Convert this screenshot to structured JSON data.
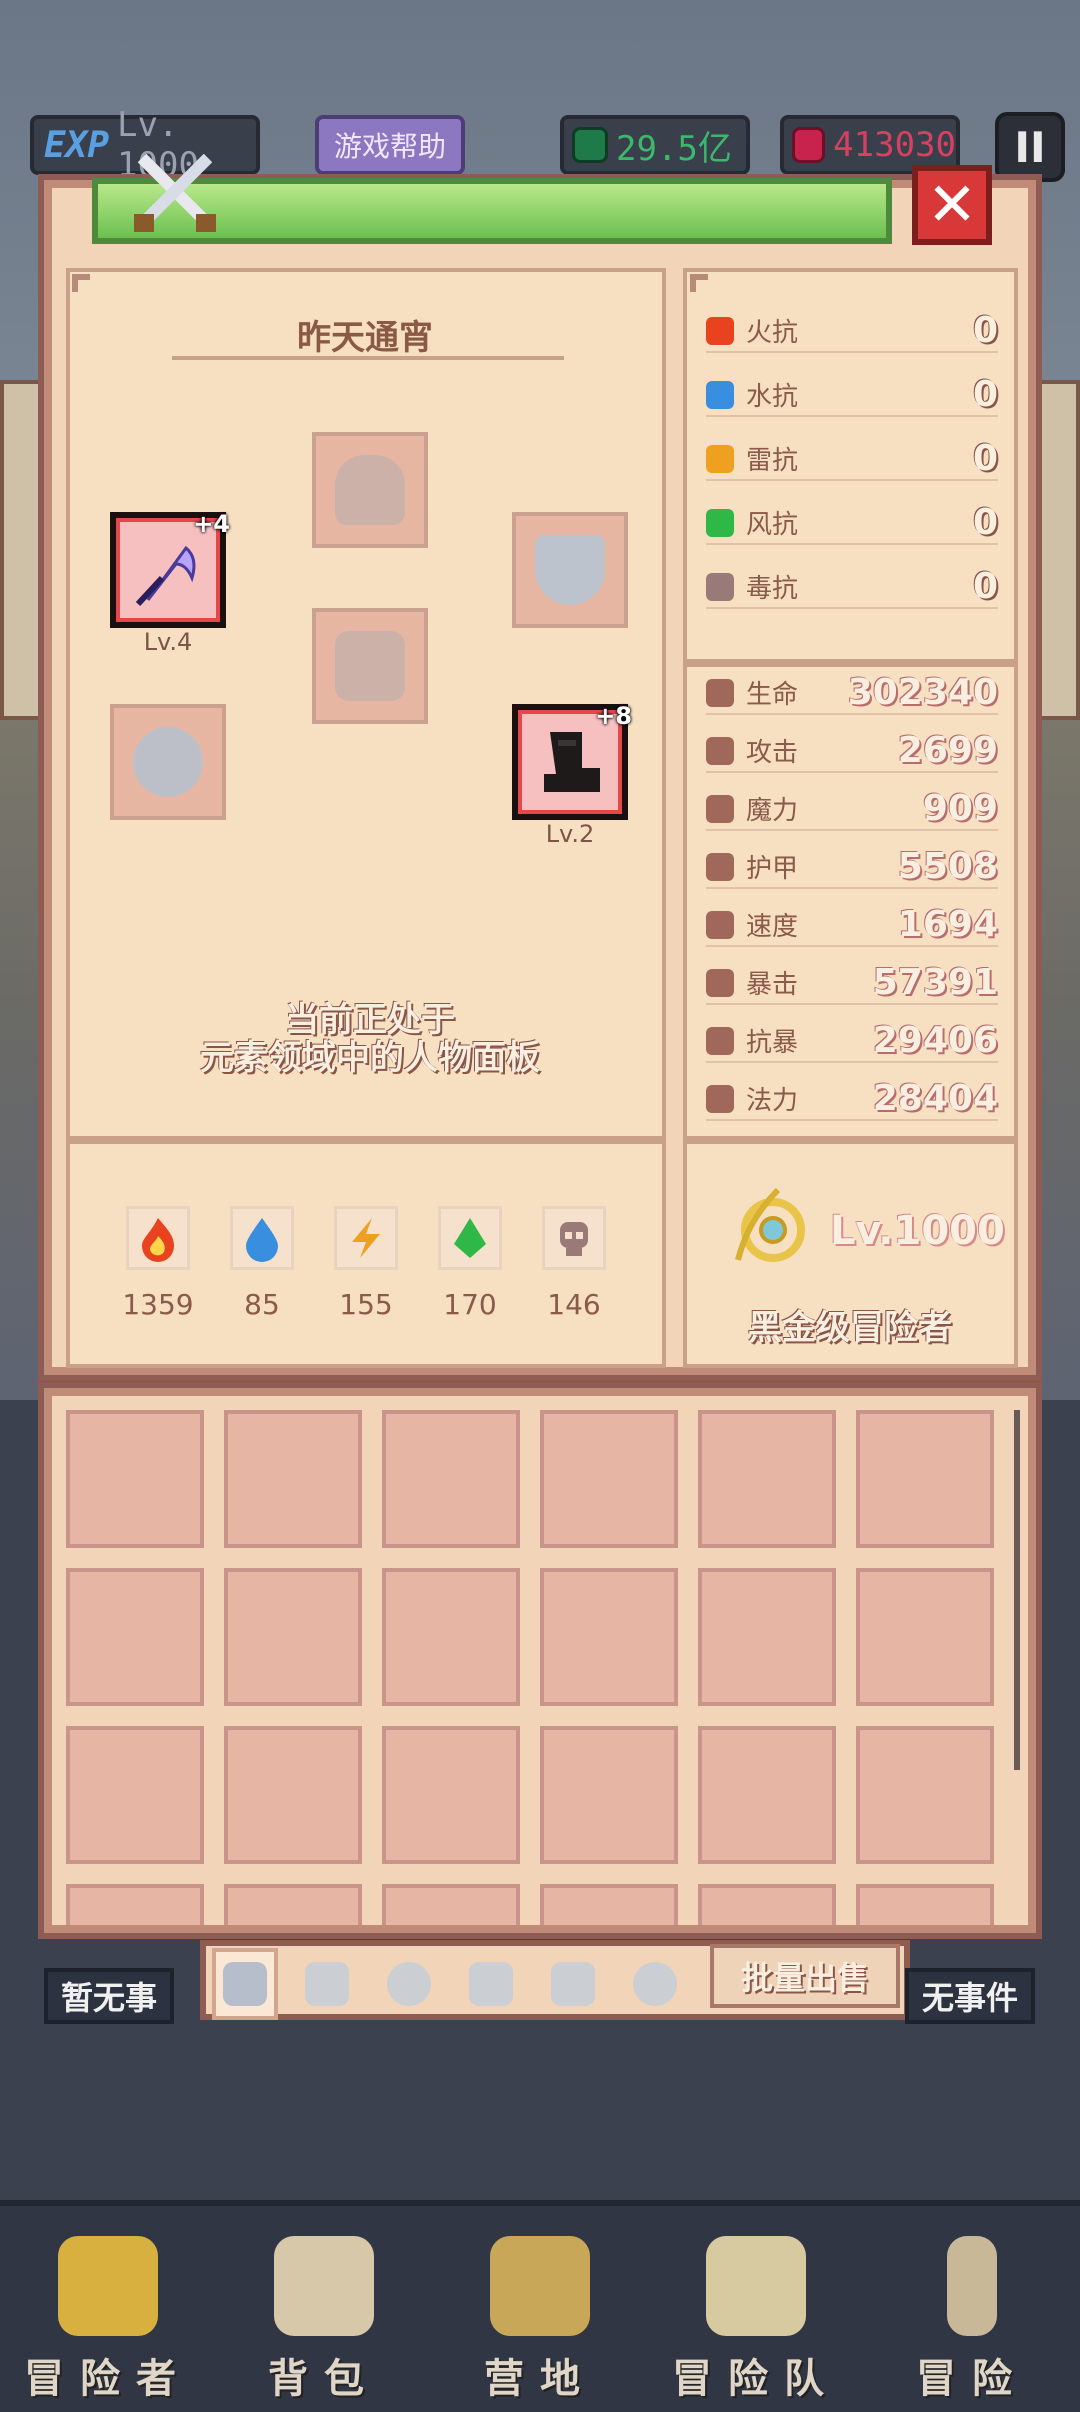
{
  "topbar": {
    "exp_badge": "EXP",
    "level_text": "Lv. 1000",
    "help_label": "游戏帮助",
    "gold_value": "29.5亿",
    "gem_value": "413030",
    "pause_symbol": "II"
  },
  "panel": {
    "close_symbol": "✕",
    "character_name": "昨天通宵",
    "info_line1": "当前正处于",
    "info_line2": "元素领域中的人物面板"
  },
  "equipment": {
    "weapon": {
      "plus": "+4",
      "level": "Lv.4"
    },
    "boots": {
      "plus": "+8",
      "level": "Lv.2"
    }
  },
  "elements": [
    {
      "name": "fire",
      "value": "1359",
      "color": "#e8421e"
    },
    {
      "name": "water",
      "value": "85",
      "color": "#3a8ee0"
    },
    {
      "name": "thunder",
      "value": "155",
      "color": "#f0a020"
    },
    {
      "name": "wind",
      "value": "170",
      "color": "#2fb848"
    },
    {
      "name": "poison",
      "value": "146",
      "color": "#9a7a78"
    }
  ],
  "resistances": [
    {
      "label": "火抗",
      "value": "0",
      "color": "#e8421e"
    },
    {
      "label": "水抗",
      "value": "0",
      "color": "#3a8ee0"
    },
    {
      "label": "雷抗",
      "value": "0",
      "color": "#f0a020"
    },
    {
      "label": "风抗",
      "value": "0",
      "color": "#2fb848"
    },
    {
      "label": "毒抗",
      "value": "0",
      "color": "#9a7a78"
    }
  ],
  "stats": [
    {
      "label": "生命",
      "value": "302340"
    },
    {
      "label": "攻击",
      "value": "2699"
    },
    {
      "label": "魔力",
      "value": "909"
    },
    {
      "label": "护甲",
      "value": "5508"
    },
    {
      "label": "速度",
      "value": "1694"
    },
    {
      "label": "暴击",
      "value": "57391"
    },
    {
      "label": "抗暴",
      "value": "29406"
    },
    {
      "label": "法力",
      "value": "28404"
    }
  ],
  "rank": {
    "level": "Lv.1000",
    "title": "黑金级冒险者"
  },
  "inventory": {
    "batch_sell_label": "批量出售",
    "tab_icons": [
      "sword-icon",
      "shield-icon",
      "helmet-icon",
      "armor-icon",
      "pants-icon",
      "ring-icon"
    ]
  },
  "events": {
    "left": "暂无事",
    "right": "无事件"
  },
  "bottom_nav": [
    {
      "label": "冒险者",
      "icon": "crown-icon"
    },
    {
      "label": "背包",
      "icon": "backpack-icon"
    },
    {
      "label": "营地",
      "icon": "camp-icon"
    },
    {
      "label": "冒险队",
      "icon": "team-book-icon"
    },
    {
      "label": "冒险",
      "icon": "adventure-icon"
    }
  ]
}
